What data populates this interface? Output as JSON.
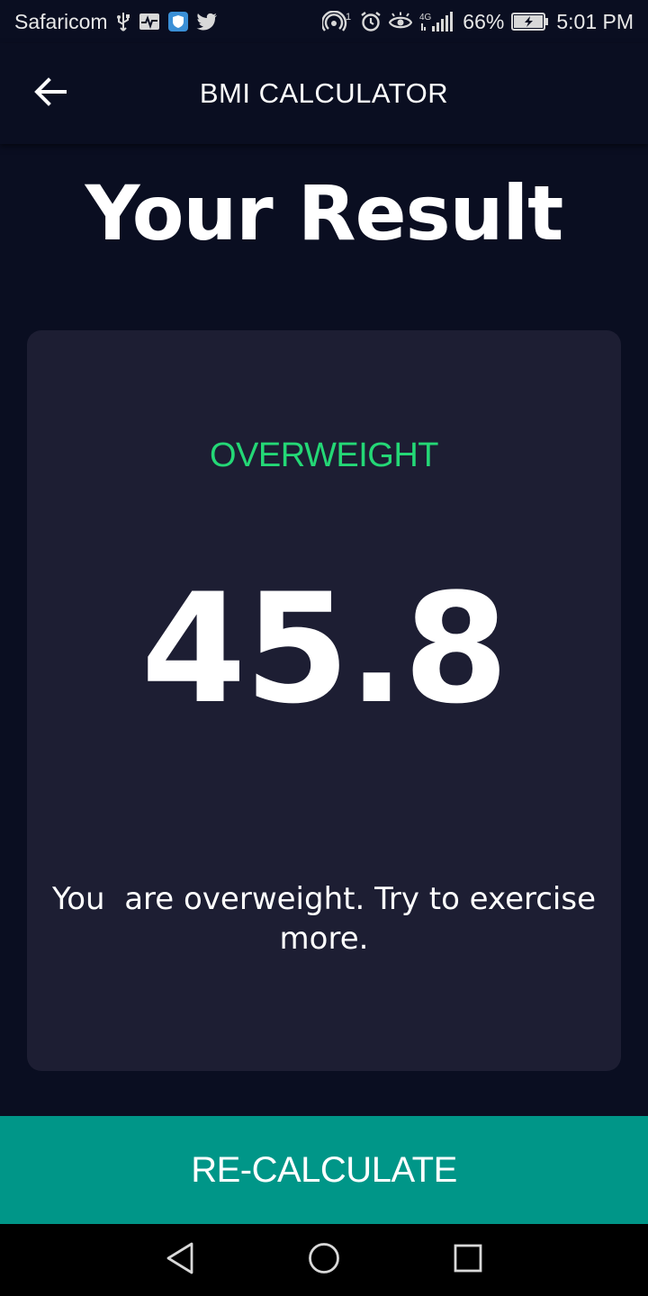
{
  "status_bar": {
    "carrier": "Safaricom",
    "network": "4G",
    "battery_percent": "66%",
    "time": "5:01 PM",
    "left_icons": [
      "usb-icon",
      "activity-icon",
      "shield-app-icon",
      "twitter-icon"
    ],
    "right_icons": [
      "hotspot-icon",
      "alarm-icon",
      "eye-comfort-icon",
      "signal-icon",
      "battery-icon"
    ]
  },
  "app_bar": {
    "title": "BMI CALCULATOR",
    "back_icon": "arrow-left-icon"
  },
  "page": {
    "title": "Your Result"
  },
  "result": {
    "status": "OVERWEIGHT",
    "bmi": "45.8",
    "interpretation": "You  are overweight. Try to exercise more."
  },
  "actions": {
    "recalculate_label": "RE-CALCULATE"
  },
  "nav_bar": {
    "icons": [
      "back-triangle-icon",
      "home-circle-icon",
      "recents-square-icon"
    ]
  },
  "colors": {
    "background": "#0a0e21",
    "card": "#1d1e33",
    "status_green": "#24d876",
    "button_teal": "#009688"
  }
}
